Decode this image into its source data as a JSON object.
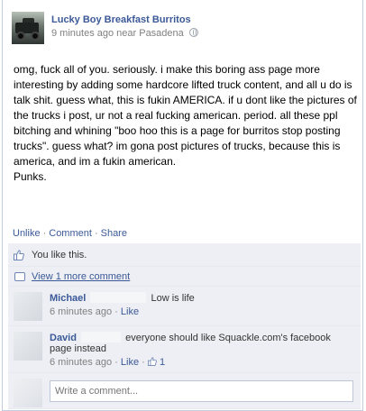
{
  "post": {
    "page_name": "Lucky Boy Breakfast Burritos",
    "time": "9 minutes ago near Pasadena",
    "text": "omg, fuck all of you. seriously. i make this boring ass page more interesting by adding some hardcore lifted truck content, and all u do is talk shit. guess what, this is fukin AMERICA. if u dont like the pictures of the trucks i post, ur not a real fucking american. period. all these ppl bitching and whining \"boo hoo this is a page for burritos stop posting trucks\". guess what? im gona post pictures of trucks, because this is america, and im a fukin american.\nPunks."
  },
  "actions": {
    "unlike": "Unlike",
    "comment": "Comment",
    "share": "Share",
    "separator": "·"
  },
  "ufi": {
    "likes_text": "You like this.",
    "more_comments": "View 1 more comment",
    "comments": [
      {
        "name": "Michael",
        "text": "Low is life",
        "time": "6 minutes ago",
        "like": "Like",
        "like_count": ""
      },
      {
        "name": "David",
        "text": "everyone should like Squackle.com's facebook page instead",
        "time": "6 minutes ago",
        "like": "Like",
        "like_count": "1"
      }
    ],
    "write_placeholder": "Write a comment..."
  },
  "colors": {
    "link": "#3b5998",
    "ufi_bg": "#edeff4",
    "meta": "#808080"
  },
  "icons": {
    "privacy": "globe-icon",
    "like": "thumb-icon",
    "more": "comment-icon"
  }
}
